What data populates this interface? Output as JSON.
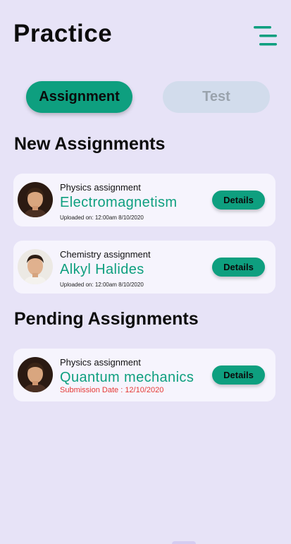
{
  "header": {
    "title": "Practice",
    "menu_icon": "menu-icon"
  },
  "tabs": [
    {
      "label": "Assignment",
      "active": true
    },
    {
      "label": "Test",
      "active": false
    }
  ],
  "sections": {
    "new_title": "New Assignments",
    "pending_title": "Pending Assignments"
  },
  "new_assignments": [
    {
      "type": "Physics assignment",
      "title": "Electromagnetism",
      "meta": "Uploaded on: 12:00am 8/10/2020",
      "button": "Details",
      "avatar": "female-avatar"
    },
    {
      "type": "Chemistry assignment",
      "title": "Alkyl Halides",
      "meta": "Uploaded on: 12:00am 8/10/2020",
      "button": "Details",
      "avatar": "male-avatar"
    }
  ],
  "pending_assignments": [
    {
      "type": "Physics assignment",
      "title": "Quantum mechanics",
      "meta": "Submission Date : 12/10/2020",
      "button": "Details",
      "avatar": "female-avatar"
    }
  ],
  "colors": {
    "accent": "#0e9f7f",
    "background": "#e7e3f7",
    "card": "#f6f4fd",
    "danger": "#e53935",
    "inactive_tab": "#d2dcec"
  }
}
